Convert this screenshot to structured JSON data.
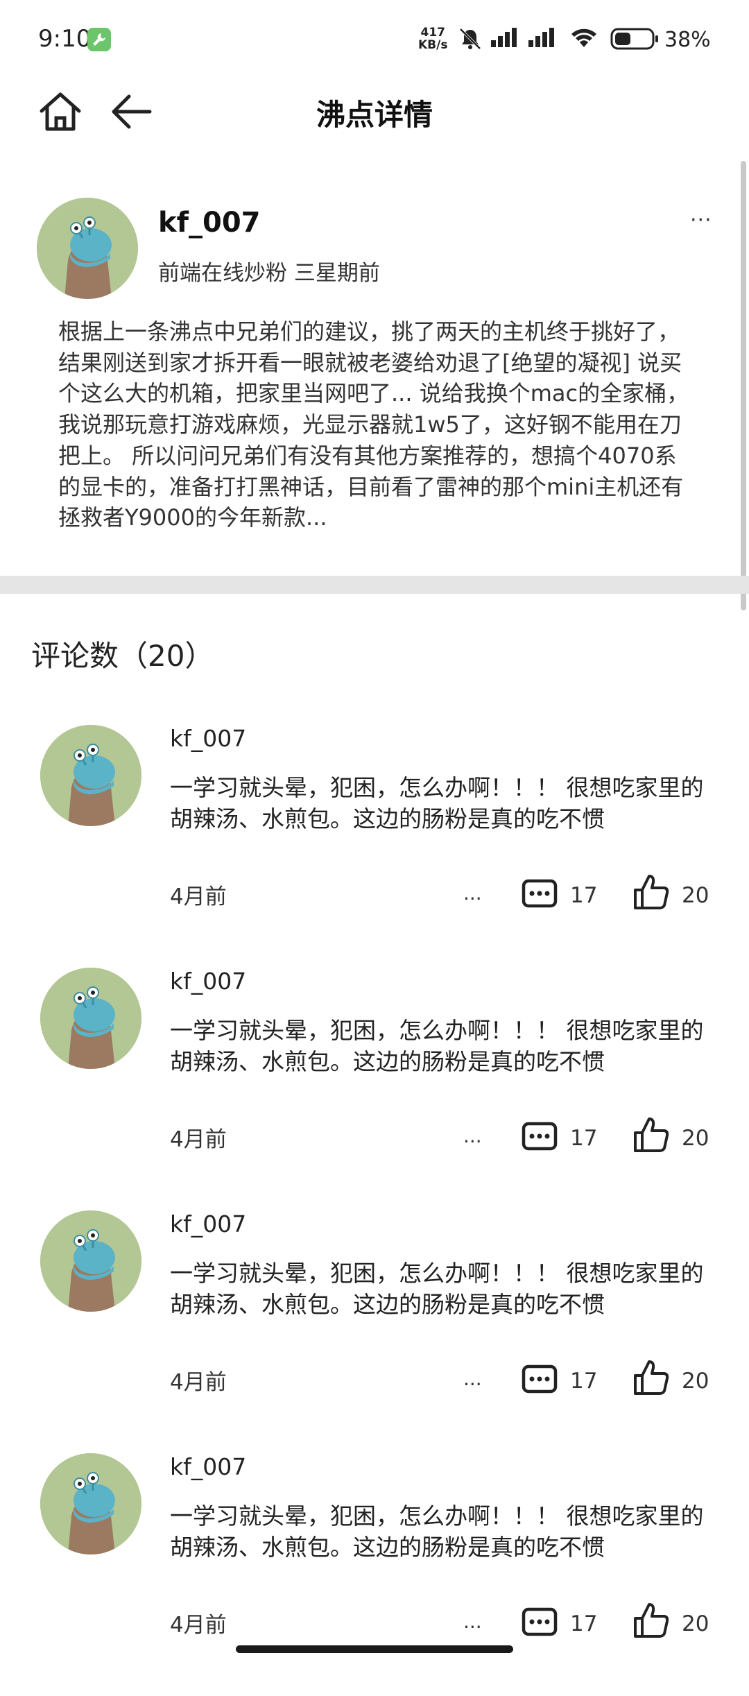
{
  "status_bar": {
    "time": "9:10",
    "net_speed_value": "417",
    "net_speed_unit": "KB/s",
    "battery_percent": "38%"
  },
  "header": {
    "title": "沸点详情"
  },
  "post": {
    "username": "kf_007",
    "meta": "前端在线炒粉 三星期前",
    "more": "···",
    "body": "根据上一条沸点中兄弟们的建议，挑了两天的主机终于挑好了，结果刚送到家才拆开看一眼就被老婆给劝退了[绝望的凝视] 说买个这么大的机箱，把家里当网吧了... 说给我换个mac的全家桶，我说那玩意打游戏麻烦，光显示器就1w5了，这好钢不能用在刀把上。 所以问问兄弟们有没有其他方案推荐的，想搞个4070系的显卡的，准备打打黑神话，目前看了雷神的那个mini主机还有拯救者Y9000的今年新款..."
  },
  "comments_section": {
    "title": "评论数（20）"
  },
  "comments": [
    {
      "username": "kf_007",
      "text": "一学习就头晕，犯困，怎么办啊！！！ 很想吃家里的胡辣汤、水煎包。这边的肠粉是真的吃不惯",
      "time": "4月前",
      "more": "...",
      "comment_count": "17",
      "like_count": "20"
    },
    {
      "username": "kf_007",
      "text": "一学习就头晕，犯困，怎么办啊！！！ 很想吃家里的胡辣汤、水煎包。这边的肠粉是真的吃不惯",
      "time": "4月前",
      "more": "...",
      "comment_count": "17",
      "like_count": "20"
    },
    {
      "username": "kf_007",
      "text": "一学习就头晕，犯困，怎么办啊！！！ 很想吃家里的胡辣汤、水煎包。这边的肠粉是真的吃不惯",
      "time": "4月前",
      "more": "...",
      "comment_count": "17",
      "like_count": "20"
    },
    {
      "username": "kf_007",
      "text": "一学习就头晕，犯困，怎么办啊！！！ 很想吃家里的胡辣汤、水煎包。这边的肠粉是真的吃不惯",
      "time": "4月前",
      "more": "...",
      "comment_count": "17",
      "like_count": "20"
    }
  ],
  "icons": {
    "home": "home-icon",
    "back": "arrow-left-icon",
    "comment": "comment-bubble-icon",
    "like": "thumbs-up-icon",
    "wrench": "wrench-icon",
    "mute": "bell-off-icon",
    "signal": "signal-icon",
    "wifi": "wifi-icon",
    "battery": "battery-icon"
  },
  "colors": {
    "avatar_bg": "#b3c795",
    "divider": "#e5e5e5",
    "app_badge": "#6cc56a"
  }
}
